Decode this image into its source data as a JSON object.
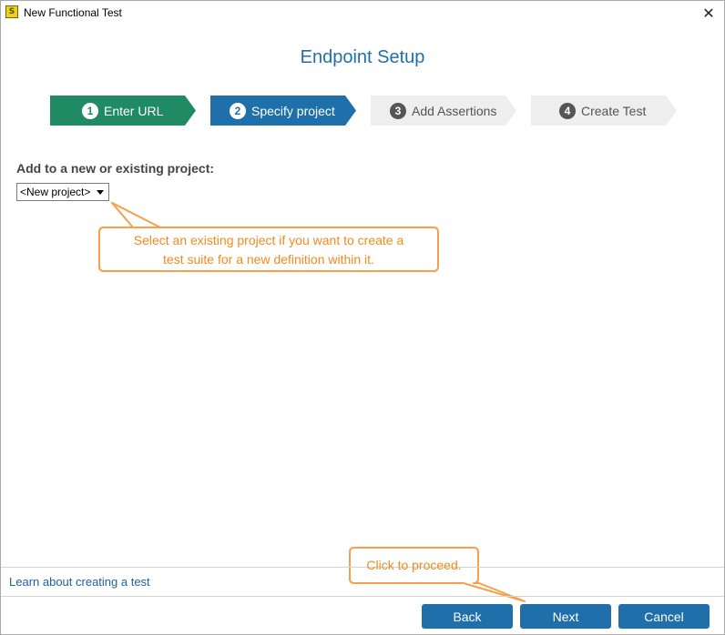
{
  "window": {
    "title": "New Functional Test",
    "app_icon": "soapui-icon",
    "close_glyph": "✕"
  },
  "heading": "Endpoint Setup",
  "steps": [
    {
      "num": "1",
      "label": "Enter URL",
      "state": "completed",
      "color": "#1f8a63"
    },
    {
      "num": "2",
      "label": "Specify project",
      "state": "current",
      "color": "#1f6fab"
    },
    {
      "num": "3",
      "label": "Add Assertions",
      "state": "pending",
      "color": "#eeeeee"
    },
    {
      "num": "4",
      "label": "Create Test",
      "state": "pending",
      "color": "#eeeeee"
    }
  ],
  "form": {
    "project_label": "Add to a new or existing project:",
    "project_select_value": "<New project>"
  },
  "callouts": {
    "project_hint_line1": "Select an existing project if you want to create a",
    "project_hint_line2": "test suite for a new definition within it.",
    "next_hint": "Click to proceed.",
    "color": "#f28a1e"
  },
  "footer": {
    "learn_link": "Learn about creating a test",
    "back_label": "Back",
    "next_label": "Next",
    "cancel_label": "Cancel"
  },
  "colors": {
    "accent": "#1f6fab",
    "completed": "#1f8a63"
  }
}
